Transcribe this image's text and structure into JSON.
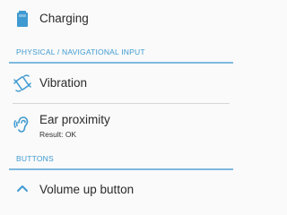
{
  "items_top": {
    "charging": {
      "label": "Charging",
      "icon": "battery-icon"
    }
  },
  "sections": {
    "physical": {
      "label": "PHYSICAL / NAVIGATIONAL INPUT",
      "items": {
        "vibration": {
          "label": "Vibration",
          "icon": "vibration-icon"
        },
        "ear_proximity": {
          "label": "Ear proximity",
          "result": "Result: OK",
          "icon": "ear-icon"
        }
      }
    },
    "buttons": {
      "label": "BUTTONS",
      "items": {
        "volume_up": {
          "label": "Volume up button",
          "icon": "chevron-up-icon"
        }
      }
    }
  },
  "colors": {
    "accent": "#3f9ad1",
    "header_line": "#7fb9de",
    "text": "#2a2a2a",
    "background": "#fafafa"
  }
}
